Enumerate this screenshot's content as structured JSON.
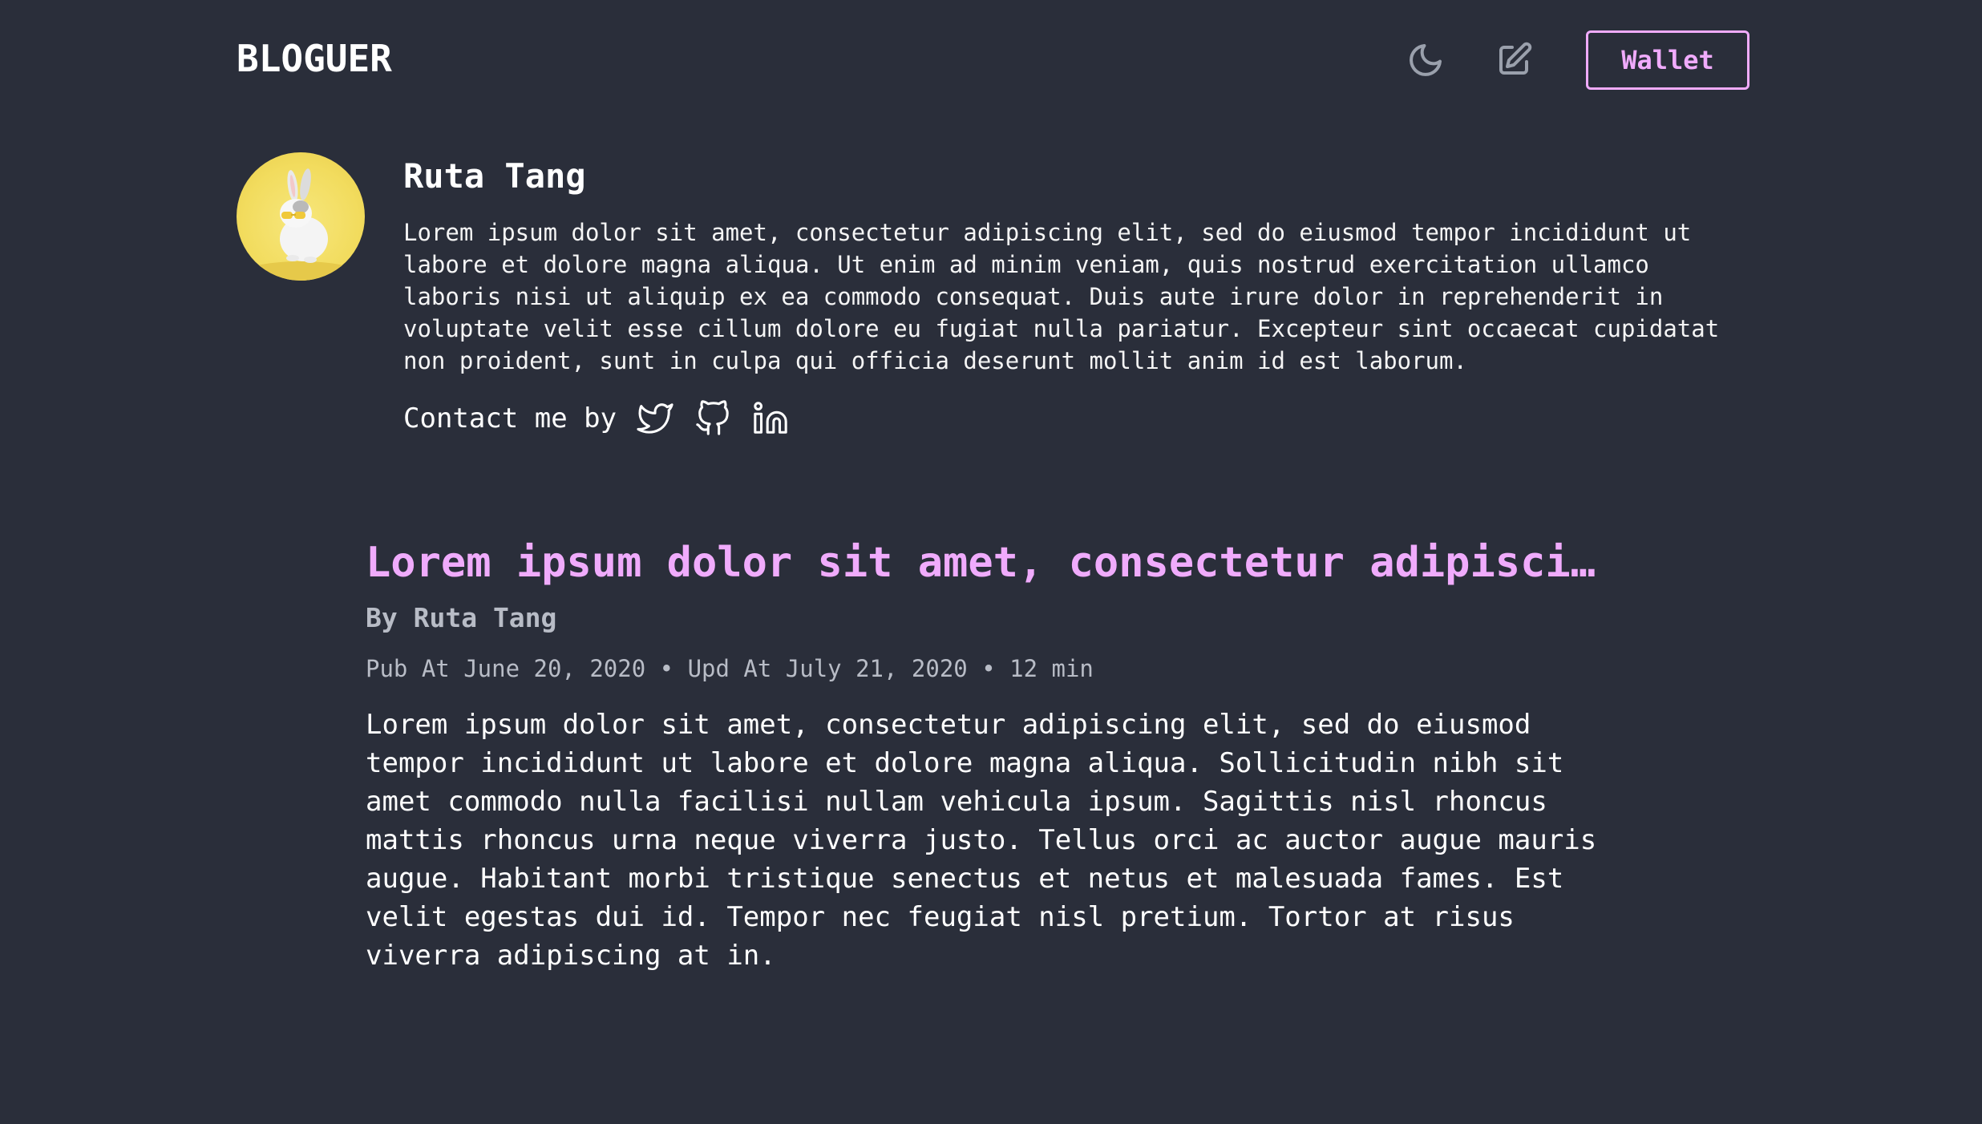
{
  "header": {
    "logo": "BLOGUER",
    "theme_icon": "moon-icon",
    "edit_icon": "edit-icon",
    "wallet_label": "Wallet"
  },
  "profile": {
    "name": "Ruta Tang",
    "bio": "Lorem ipsum dolor sit amet, consectetur adipiscing elit, sed do eiusmod tempor incididunt ut labore et dolore magna aliqua. Ut enim ad minim veniam, quis nostrud exercitation ullamco laboris nisi ut aliquip ex ea commodo consequat. Duis aute irure dolor in reprehenderit in voluptate velit esse cillum dolore eu fugiat nulla pariatur. Excepteur sint occaecat cupidatat non proident, sunt in culpa qui officia deserunt mollit anim id est laborum.",
    "contact_label": "Contact me by",
    "socials": [
      "twitter-icon",
      "github-icon",
      "linkedin-icon"
    ]
  },
  "post": {
    "title": "Lorem ipsum dolor sit amet, consectetur adipiscing elit",
    "author": "By Ruta Tang",
    "meta": "Pub At June 20, 2020 • Upd At July 21, 2020 • 12 min",
    "excerpt": "Lorem ipsum dolor sit amet, consectetur adipiscing elit, sed do eiusmod tempor incididunt ut labore et dolore magna aliqua. Sollicitudin nibh sit amet commodo nulla facilisi nullam vehicula ipsum. Sagittis nisl rhoncus mattis rhoncus urna neque viverra justo. Tellus orci ac auctor augue mauris augue. Habitant morbi tristique senectus et netus et malesuada fames. Est velit egestas dui id. Tempor nec feugiat nisl pretium. Tortor at risus viverra adipiscing at in."
  },
  "colors": {
    "background": "#2a2e3a",
    "accent": "#f0abfc",
    "muted": "#b8bcc6",
    "icon_gray": "#9aa0ac"
  }
}
